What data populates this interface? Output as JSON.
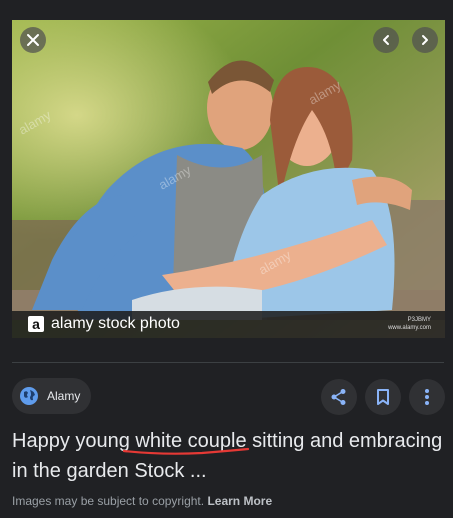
{
  "image": {
    "alt": "",
    "watermark_logo": "a",
    "watermark_text": "alamy stock photo",
    "watermark_id": "P3JBMY",
    "watermark_site": "www.alamy.com",
    "overlay_text": "alamy"
  },
  "controls": {
    "close_icon": "close-icon",
    "prev_icon": "chevron-left-icon",
    "next_icon": "chevron-right-icon"
  },
  "source": {
    "name": "Alamy",
    "icon": "globe-icon"
  },
  "actions": {
    "share_icon": "share-icon",
    "save_icon": "bookmark-icon",
    "more_icon": "more-vert-icon"
  },
  "title": {
    "before": "Happy young ",
    "highlight": "white couple",
    "after": " sitting and embracing in the garden Stock ..."
  },
  "copyright": {
    "text": "Images may be subject to copyright.",
    "link": "Learn More"
  },
  "colors": {
    "background": "#202124",
    "chip": "#303134",
    "accent_icon": "#8ab4f8",
    "underline": "#e53935"
  }
}
